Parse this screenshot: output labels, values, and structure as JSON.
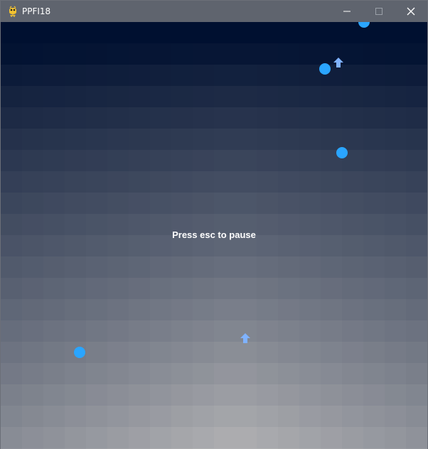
{
  "window": {
    "title": "PPFI18",
    "app_icon": "python-snake-icon",
    "buttons": [
      "minimize-icon",
      "maximize-icon",
      "close-icon"
    ]
  },
  "game": {
    "hint_text": "Press esc to pause",
    "colors": {
      "sky_top": "#001030",
      "sky_bottom": "#b2b2b4",
      "enemy_dot": "#2aa5ff",
      "projectile": "#7fb2ff",
      "text": "#ffffff"
    },
    "entities": {
      "enemy_dots": 4,
      "arrow_projectiles": 2
    }
  }
}
